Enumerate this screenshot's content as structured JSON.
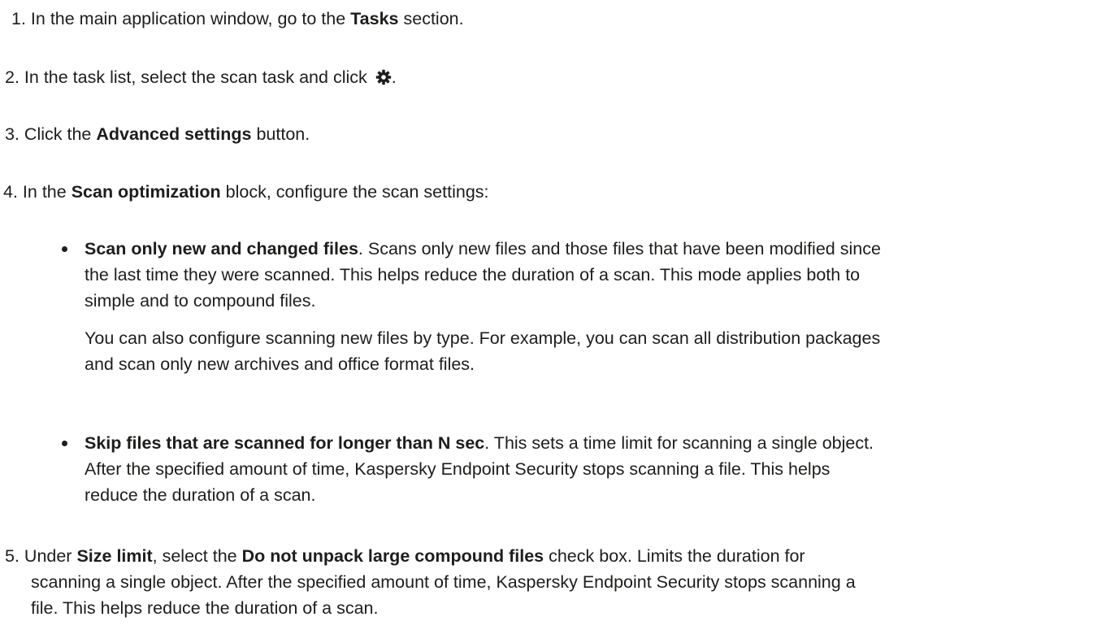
{
  "steps": [
    {
      "number": "1.",
      "pre": " In the main application window, go to the ",
      "bold": "Tasks",
      "post": " section."
    },
    {
      "number": "2.",
      "pre": " In the task list, select the scan task and click ",
      "icon": "gear-icon",
      "post": "."
    },
    {
      "number": "3.",
      "pre": " Click the ",
      "bold": "Advanced settings",
      "post": " button."
    },
    {
      "number": "4.",
      "pre": " In the ",
      "bold": "Scan optimization",
      "post": " block, configure the scan settings:"
    },
    {
      "number": "5.",
      "pre": " Under ",
      "bold": "Size limit",
      "mid": ", select the ",
      "bold2": "Do not unpack large compound files",
      "post": " check box. Limits the duration for",
      "line2": "scanning a single object. After the specified amount of time, Kaspersky Endpoint Security stops scanning a",
      "line3": "file. This helps reduce the duration of a scan."
    }
  ],
  "bullets": [
    {
      "bold": "Scan only new and changed files",
      "line1": ". Scans only new files and those files that have been modified since",
      "line2": "the last time they were scanned. This helps reduce the duration of a scan. This mode applies both to",
      "line3": "simple and to compound files.",
      "note_line1": "You can also configure scanning new files by type. For example, you can scan all distribution packages",
      "note_line2": "and scan only new archives and office format files."
    },
    {
      "bold": "Skip files that are scanned for longer than N sec",
      "line1": ". This sets a time limit for scanning a single object.",
      "line2": "After the specified amount of time, Kaspersky Endpoint Security stops scanning a file. This helps",
      "line3": "reduce the duration of a scan."
    }
  ],
  "colors": {
    "text": "#1d1d1b",
    "background": "#ffffff"
  }
}
